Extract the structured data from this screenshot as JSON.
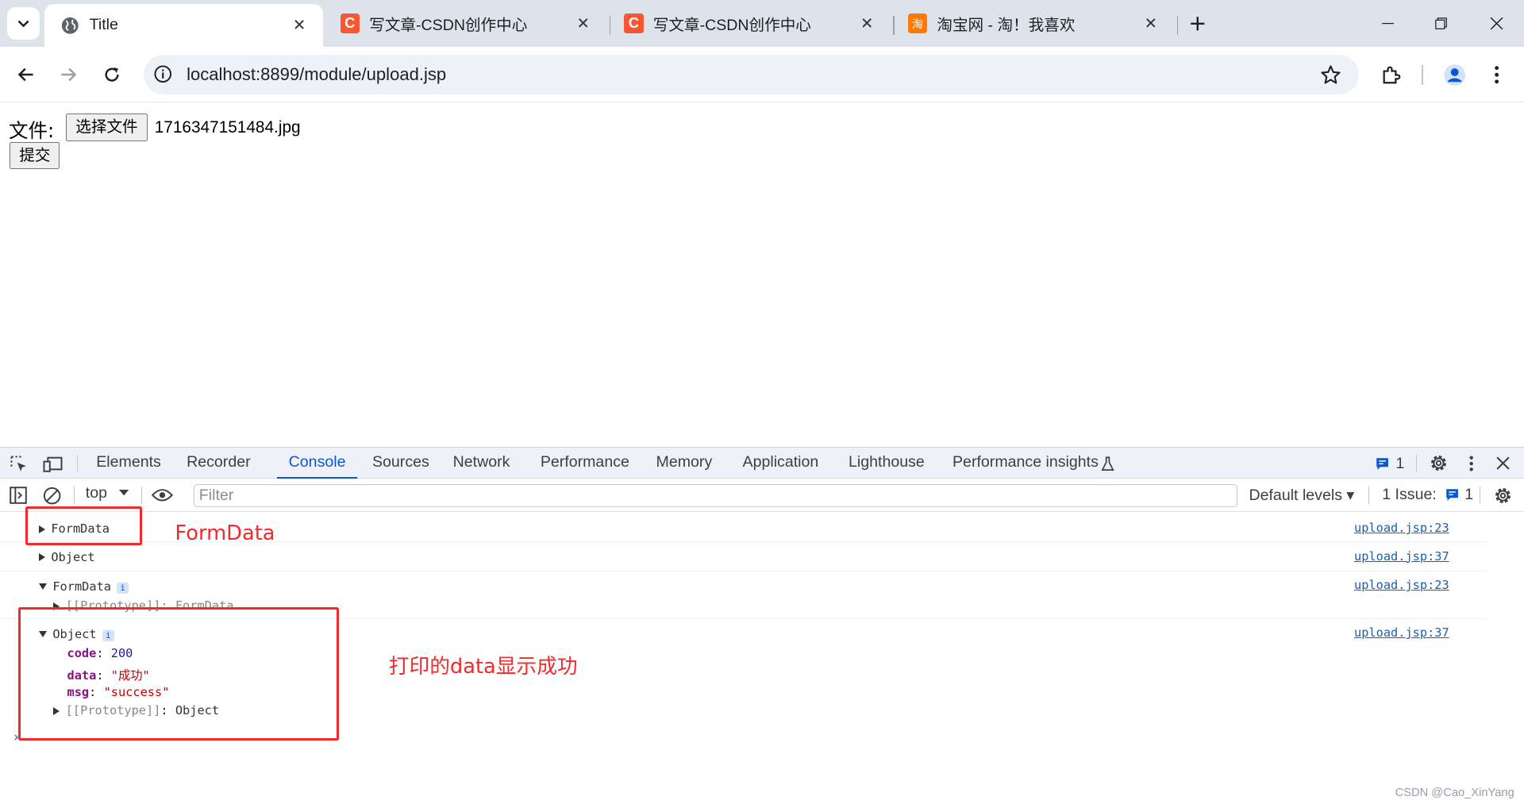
{
  "browser": {
    "tabs": [
      {
        "title": "Title",
        "favicon": "globe-icon"
      },
      {
        "title": "写文章-CSDN创作中心",
        "favicon": "csdn-icon"
      },
      {
        "title": "写文章-CSDN创作中心",
        "favicon": "csdn-icon"
      },
      {
        "title": "淘宝网 - 淘！我喜欢",
        "favicon": "taobao-icon"
      }
    ],
    "csdn_favicon_letter": "C",
    "taobao_favicon_text": "淘",
    "url": "localhost:8899/module/upload.jsp"
  },
  "page": {
    "file_label": "文件:",
    "choose_file_button": "选择文件",
    "file_name": "1716347151484.jpg",
    "submit_button": "提交"
  },
  "devtools": {
    "tabs": [
      "Elements",
      "Recorder",
      "Console",
      "Sources",
      "Network",
      "Performance",
      "Memory",
      "Application",
      "Lighthouse",
      "Performance insights"
    ],
    "selected_tab": "Console",
    "message_count": "1",
    "context": "top",
    "filter_placeholder": "Filter",
    "levels": "Default levels ▾",
    "issues_label": "1 Issue:",
    "issues_count": "1",
    "accent_color": "#0b57d0"
  },
  "console": {
    "rows": [
      {
        "text": "FormData",
        "source": "upload.jsp:23"
      },
      {
        "text": "Object",
        "source": "upload.jsp:37"
      },
      {
        "text": "FormData",
        "source": "upload.jsp:23",
        "child": "[[Prototype]]: FormData"
      },
      {
        "text": "Object",
        "source": "upload.jsp:37"
      }
    ],
    "info_badge": "i",
    "object_props": {
      "code_key": "code",
      "code_val": "200",
      "data_key": "data",
      "data_val": "\"成功\"",
      "msg_key": "msg",
      "msg_val": "\"success\"",
      "proto_key": "[[Prototype]]",
      "proto_val": "Object"
    }
  },
  "annotations": {
    "formdata_label": "FormData",
    "success_label": "打印的data显示成功",
    "color": "#f12b2b"
  },
  "watermark": "CSDN @Cao_XinYang"
}
